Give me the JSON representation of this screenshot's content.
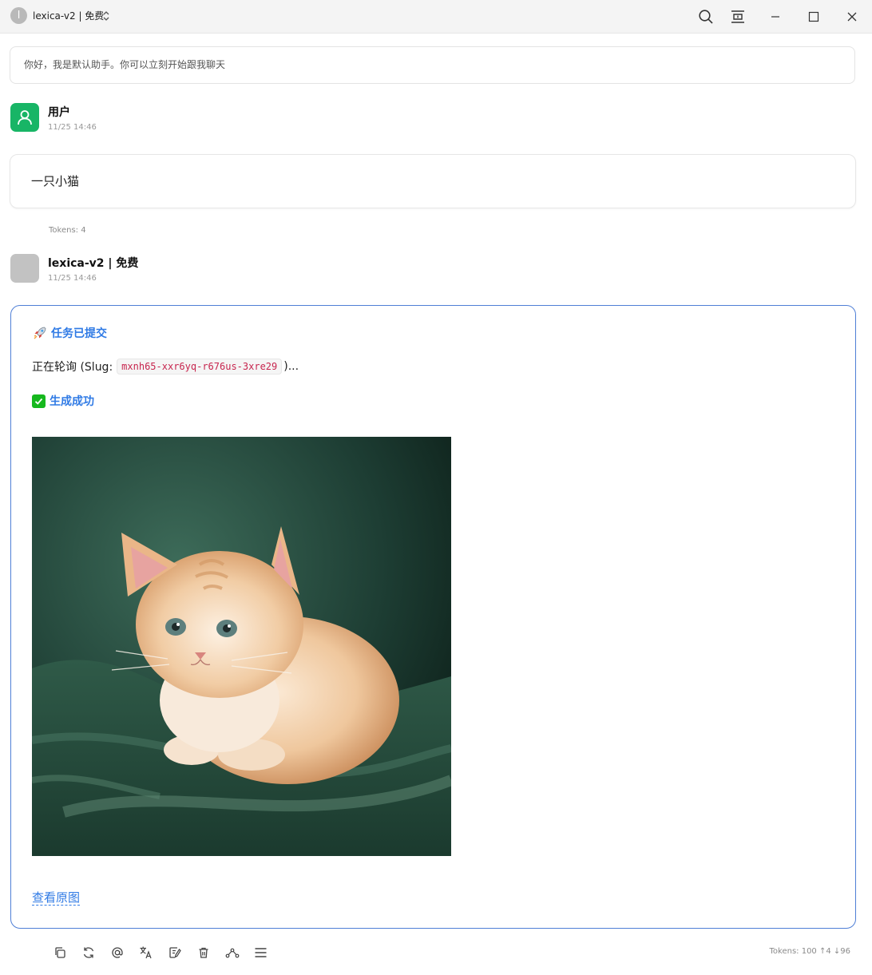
{
  "window": {
    "title": "lexica-v2 | 免费",
    "avatar_letter": "l"
  },
  "system_message": "你好，我是默认助手。你可以立刻开始跟我聊天",
  "user_message": {
    "name": "用户",
    "time": "11/25 14:46",
    "content": "一只小猫",
    "tokens": "Tokens: 4"
  },
  "bot_message": {
    "name": "lexica-v2 | 免费",
    "time": "11/25 14:46",
    "submitted": "任务已提交",
    "polling_prefix": "正在轮询 (Slug:",
    "slug": "mxnh65-xxr6yq-r676us-3xre29",
    "polling_suffix": ")...",
    "success": "生成成功",
    "view_original": "查看原图",
    "tokens": "Tokens: 100 ↑4 ↓96"
  },
  "colors": {
    "accent": "#2f7ae5",
    "user_avatar": "#18b566",
    "success": "#16b81e",
    "code_text": "#c7254e"
  },
  "toolbar_icons": [
    "copy-icon",
    "regenerate-icon",
    "mention-icon",
    "translate-icon",
    "edit-icon",
    "delete-icon",
    "branch-icon",
    "menu-icon"
  ]
}
